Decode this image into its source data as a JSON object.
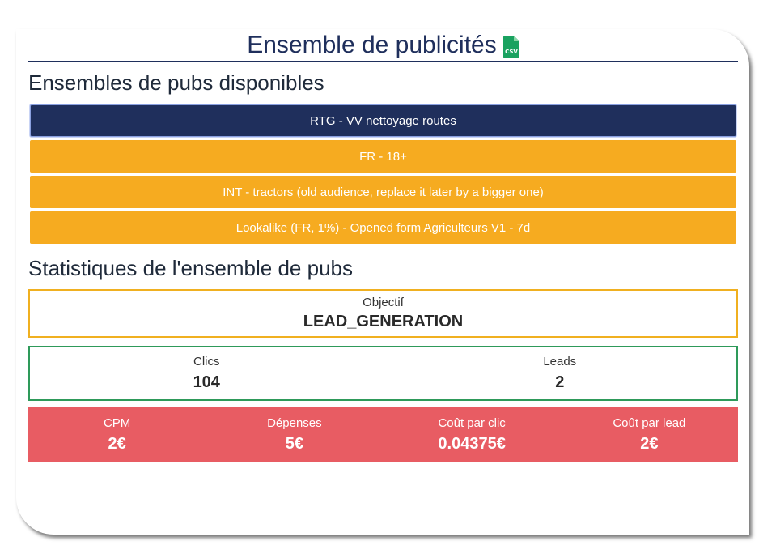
{
  "header": {
    "title": "Ensemble de publicités",
    "csv_icon": "csv-file-icon",
    "csv_icon_text": "CSV",
    "csv_color": "#1aa260"
  },
  "available": {
    "heading": "Ensembles de pubs disponibles",
    "items": [
      {
        "label": "RTG - VV nettoyage routes",
        "active": true
      },
      {
        "label": "FR - 18+",
        "active": false
      },
      {
        "label": "INT - tractors (old audience, replace it later by a bigger one)",
        "active": false
      },
      {
        "label": "Lookalike (FR, 1%) - Opened form Agriculteurs V1 - 7d",
        "active": false
      }
    ]
  },
  "stats": {
    "heading": "Statistiques de l'ensemble de pubs",
    "objective": {
      "label": "Objectif",
      "value": "LEAD_GENERATION"
    },
    "clicks": {
      "label": "Clics",
      "value": "104"
    },
    "leads": {
      "label": "Leads",
      "value": "2"
    },
    "cpm": {
      "label": "CPM",
      "value": "2€"
    },
    "spend": {
      "label": "Dépenses",
      "value": "5€"
    },
    "cpc": {
      "label": "Coût par clic",
      "value": "0.04375€"
    },
    "cpl": {
      "label": "Coût par lead",
      "value": "2€"
    }
  },
  "colors": {
    "navy": "#1f2f5c",
    "orange": "#f6ab20",
    "green_border": "#2e9a5a",
    "red": "#e85c63"
  }
}
